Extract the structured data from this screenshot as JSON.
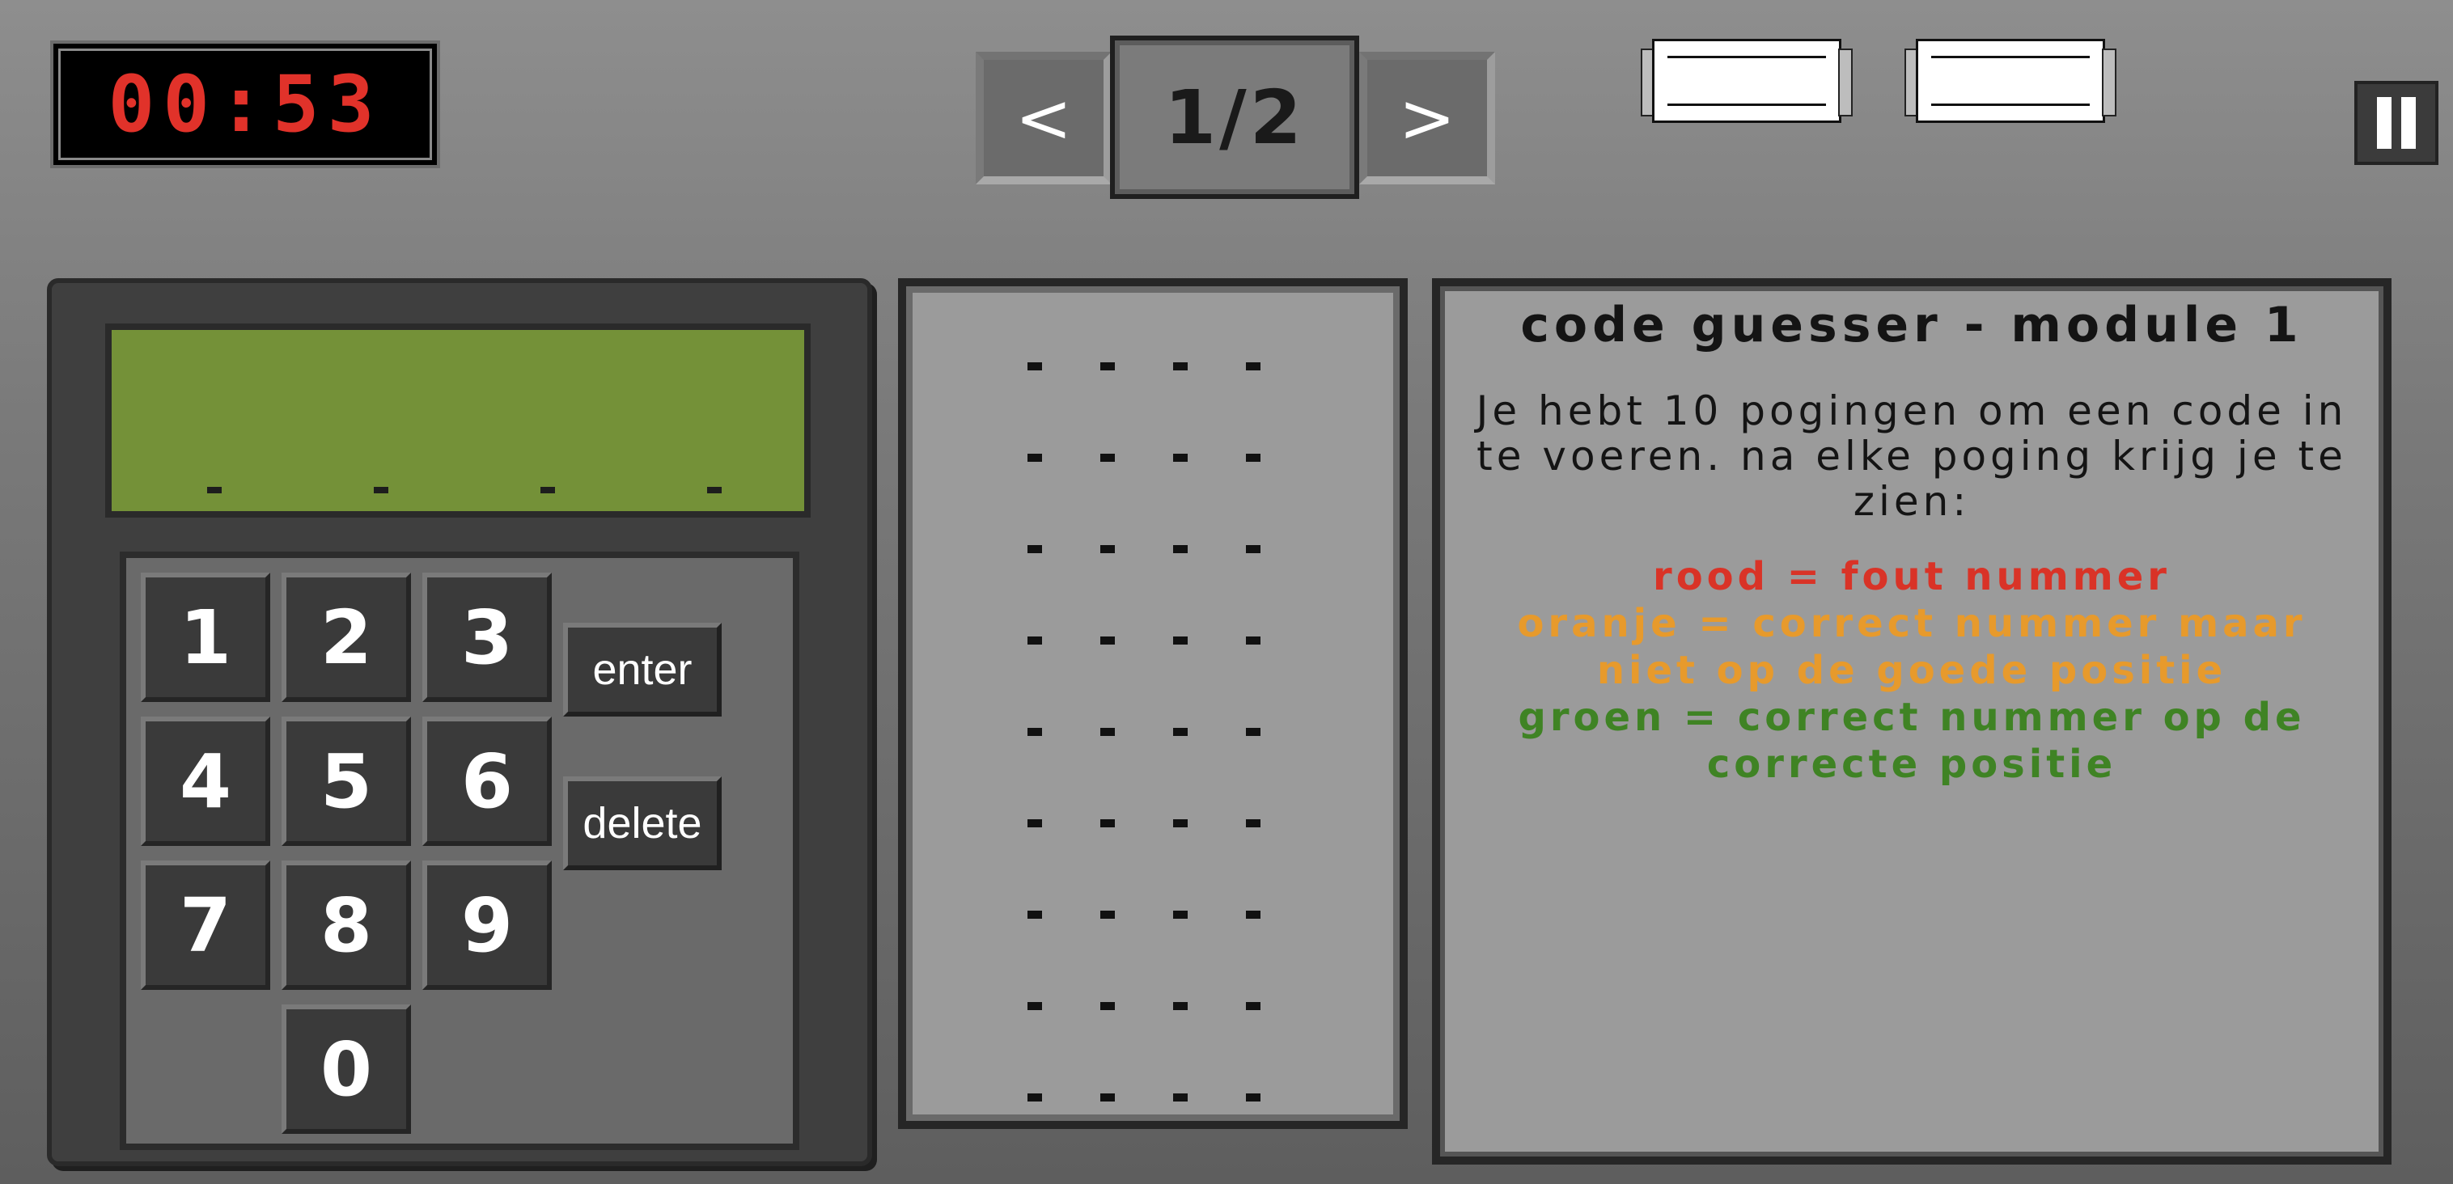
{
  "timer": {
    "value": "00:53",
    "color": "#e1322a"
  },
  "pagination": {
    "prev_label": "<",
    "next_label": ">",
    "page": "1/2"
  },
  "keypad": {
    "keys": [
      "1",
      "2",
      "3",
      "4",
      "5",
      "6",
      "7",
      "8",
      "9",
      "0"
    ],
    "enter_label": "enter",
    "delete_label": "delete",
    "display_slots": 4
  },
  "history": {
    "rows": 9,
    "slots_per_row": 4
  },
  "instructions": {
    "title": "code guesser - module 1",
    "body": "Je hebt 10 pogingen om een code in te voeren. na elke poging krijg je te zien:",
    "rule_red": "rood = fout nummer",
    "rule_orange": "oranje = correct nummer maar niet op de goede positie",
    "rule_green": "groen = correct nummer op de correcte positie"
  },
  "colors": {
    "red": "#d93327",
    "orange": "#e79a2c",
    "green": "#3f8324",
    "lcd": "#749138"
  },
  "icons": {
    "pause": "pause-icon",
    "scroll": "scroll-icon"
  }
}
